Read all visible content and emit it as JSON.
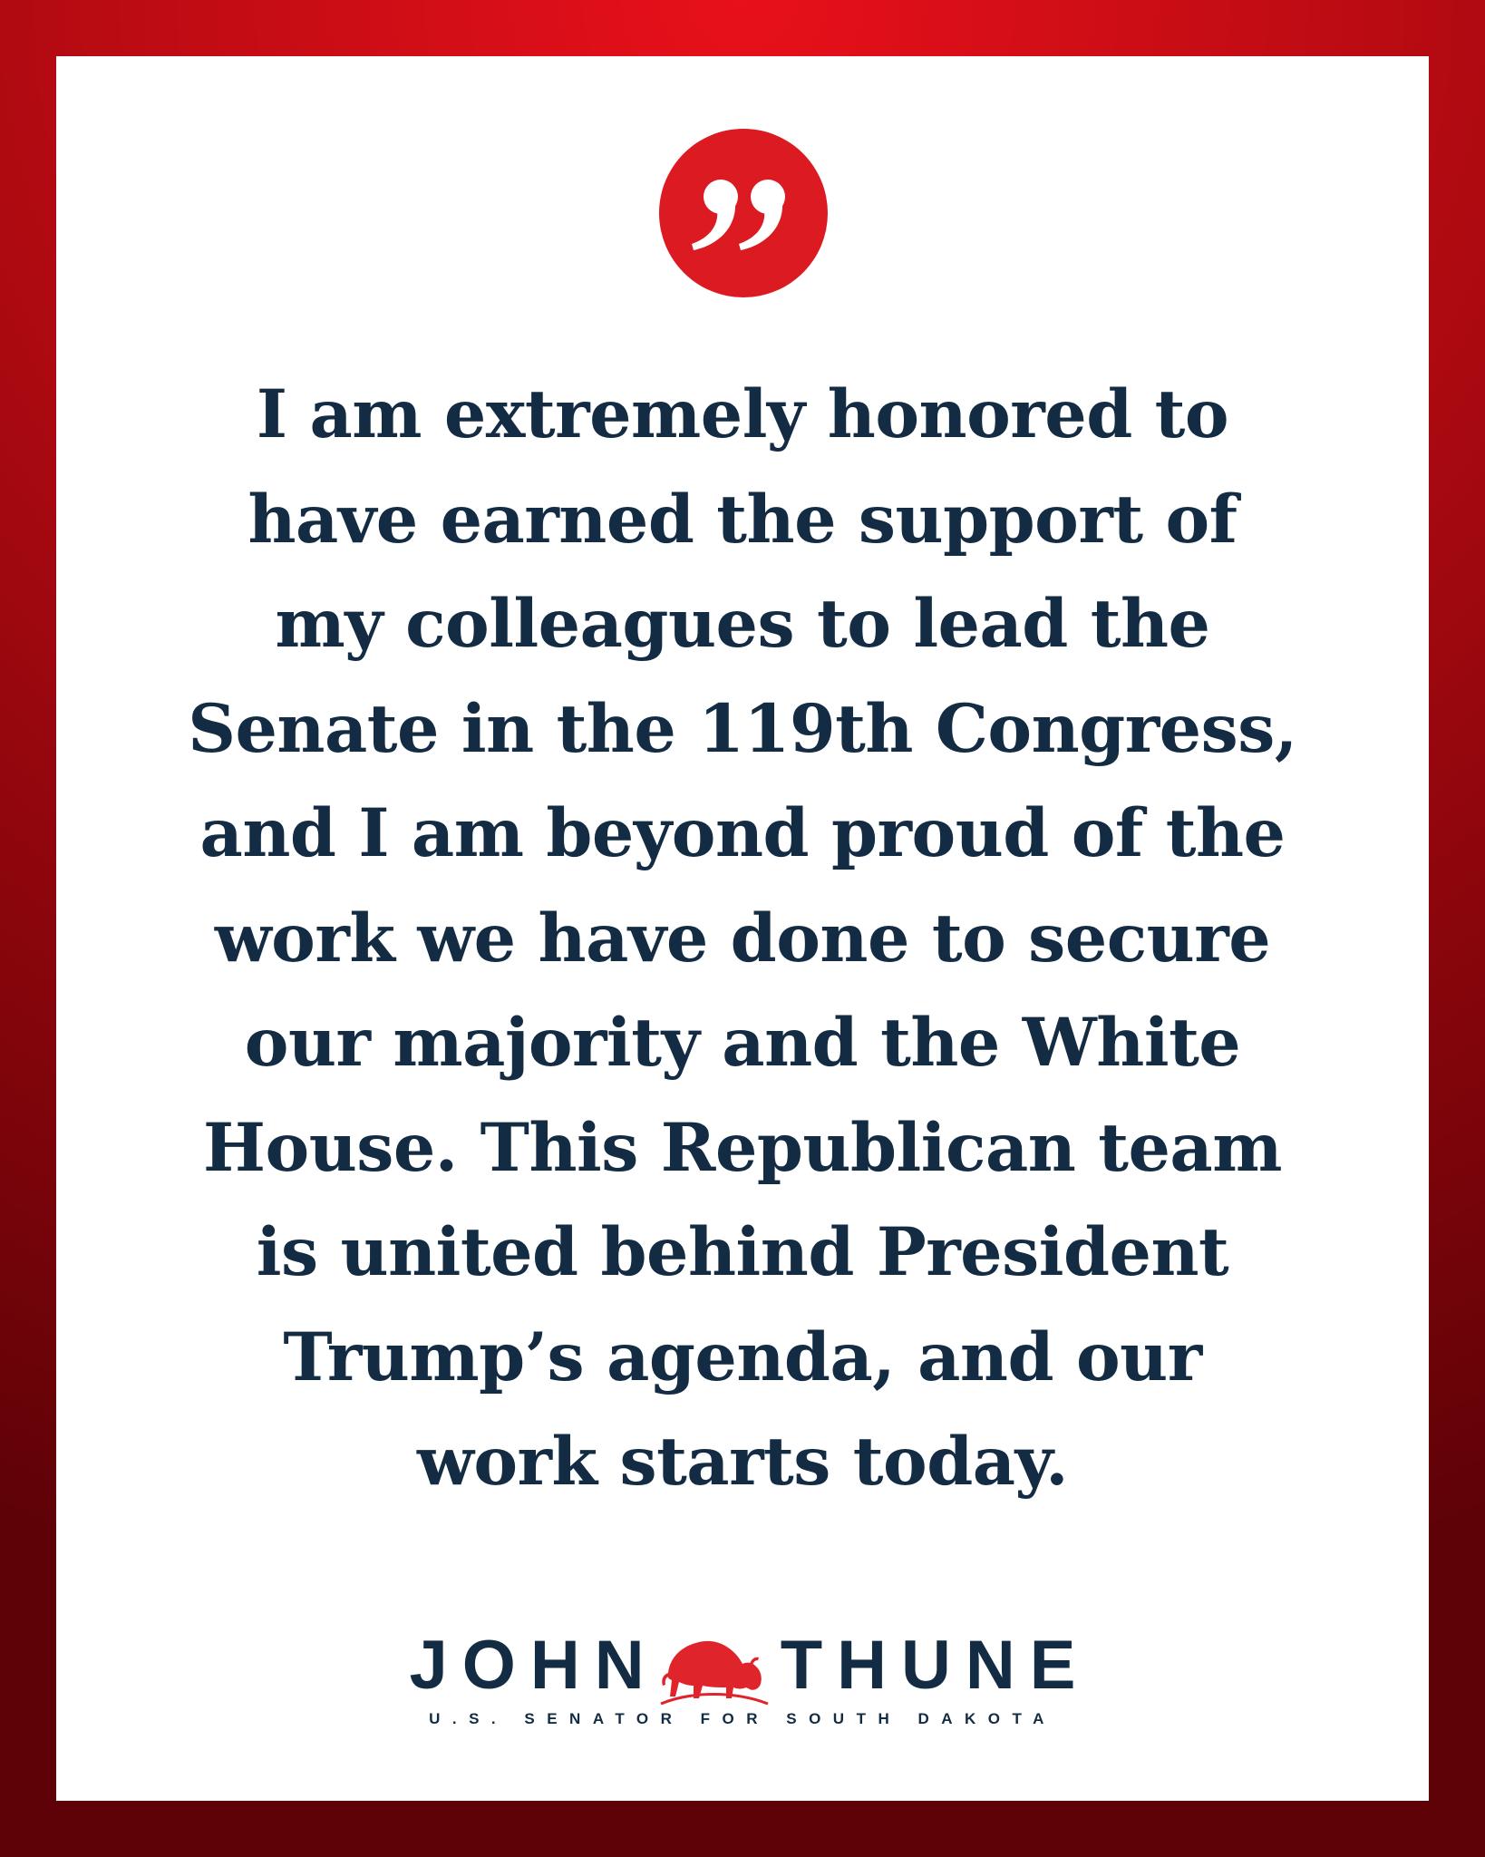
{
  "colors": {
    "border_red": "#c20c14",
    "badge_red": "#dc1a22",
    "navy": "#132c43",
    "bison_red": "#e0242c",
    "card": "#ffffff"
  },
  "quote_badge": {
    "icon": "closing-quotation-mark-icon",
    "glyph": "”"
  },
  "quote": {
    "lines": [
      "I am extremely honored to",
      "have earned the support of",
      "my colleagues to lead the",
      "Senate in the 119th Congress,",
      "and I am beyond proud of the",
      "work we have done to secure",
      "our majority and the White",
      "House. This Republican team",
      "is united behind President",
      "Trump’s agenda, and our",
      "work starts today."
    ]
  },
  "logo": {
    "first_name": "JOHN",
    "last_name": "THUNE",
    "emblem": "bison-icon",
    "tagline": "U.S. SENATOR FOR SOUTH DAKOTA"
  }
}
